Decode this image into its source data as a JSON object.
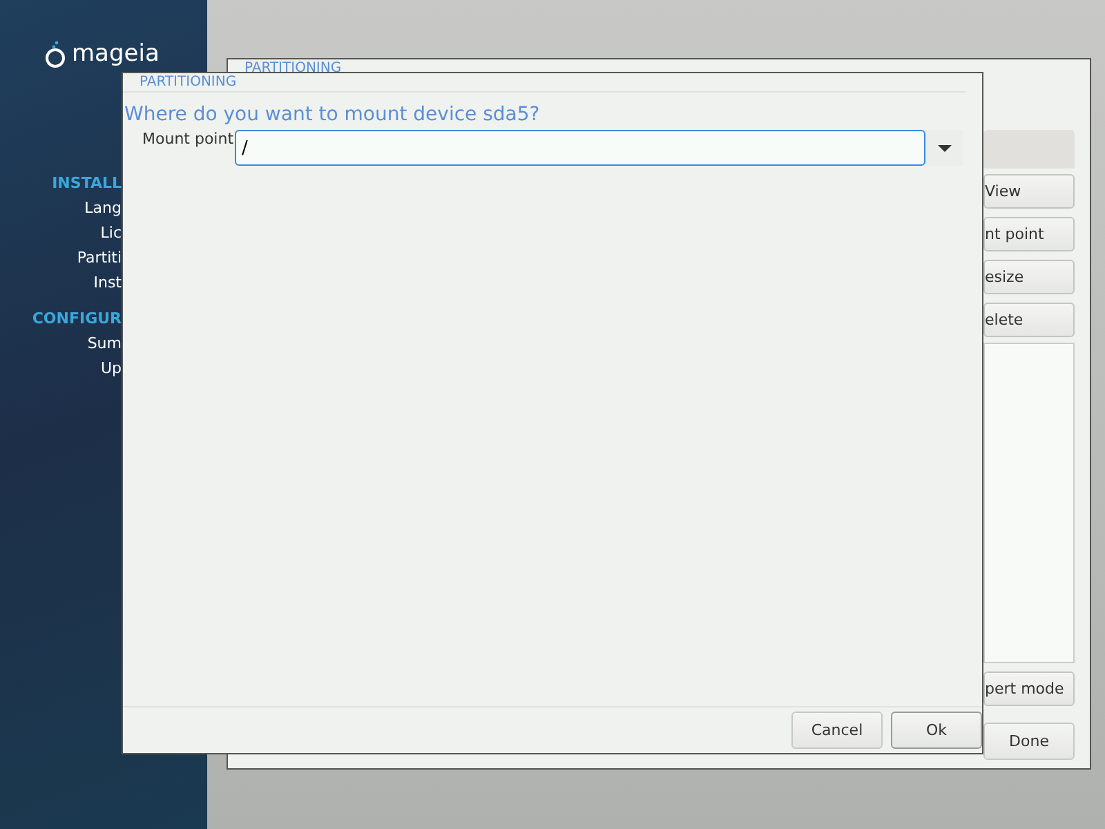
{
  "sidebar": {
    "logo": "mageia",
    "sections": [
      {
        "heading": "INSTALL",
        "items": [
          "Lang",
          "Lic",
          "Partiti",
          "Inst"
        ]
      },
      {
        "heading": "CONFIGUR",
        "items": [
          "Sum",
          "Up"
        ]
      }
    ]
  },
  "back_window": {
    "title": "PARTITIONING",
    "buttons": [
      "View",
      "nt point",
      "esize",
      "elete"
    ],
    "bottom_buttons": [
      "pert mode",
      "Done"
    ]
  },
  "dialog": {
    "title": "PARTITIONING",
    "question": "Where do you want to mount device sda5?",
    "field_label": "Mount point",
    "field_value": "/",
    "buttons": [
      {
        "label": "Cancel",
        "default": false
      },
      {
        "label": "Ok",
        "default": true
      }
    ]
  }
}
